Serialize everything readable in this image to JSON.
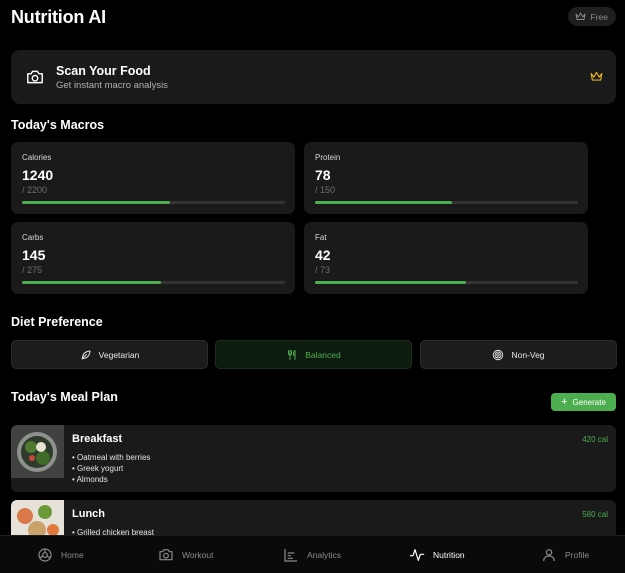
{
  "header": {
    "title": "Nutrition AI",
    "free_badge": "Free"
  },
  "scan": {
    "title": "Scan Your Food",
    "subtitle": "Get instant macro analysis"
  },
  "macros": {
    "section_title": "Today's Macros",
    "items": [
      {
        "label": "Calories",
        "value": "1240",
        "goal": "/ 2200",
        "progress": 0.564
      },
      {
        "label": "Protein",
        "value": "78",
        "goal": "/ 150",
        "progress": 0.52
      },
      {
        "label": "Carbs",
        "value": "145",
        "goal": "/ 275",
        "progress": 0.527
      },
      {
        "label": "Fat",
        "value": "42",
        "goal": "/ 73",
        "progress": 0.575
      }
    ]
  },
  "diet": {
    "section_title": "Diet Preference",
    "options": [
      {
        "label": "Vegetarian",
        "icon": "leaf-icon",
        "selected": false
      },
      {
        "label": "Balanced",
        "icon": "utensils-icon",
        "selected": true
      },
      {
        "label": "Non-Veg",
        "icon": "target-icon",
        "selected": false
      }
    ]
  },
  "meal_plan": {
    "section_title": "Today's Meal Plan",
    "generate_label": "Generate",
    "meals": [
      {
        "name": "Breakfast",
        "calories": "420 cal",
        "items": [
          "Oatmeal with berries",
          "Greek yogurt",
          "Almonds"
        ]
      },
      {
        "name": "Lunch",
        "calories": "580 cal",
        "items": [
          "Grilled chicken breast"
        ]
      }
    ]
  },
  "nav": {
    "items": [
      {
        "label": "Home",
        "icon": "home-icon",
        "active": false
      },
      {
        "label": "Workout",
        "icon": "camera-icon",
        "active": false
      },
      {
        "label": "Analytics",
        "icon": "analytics-icon",
        "active": false
      },
      {
        "label": "Nutrition",
        "icon": "activity-icon",
        "active": true
      },
      {
        "label": "Profile",
        "icon": "user-icon",
        "active": false
      }
    ]
  },
  "colors": {
    "accent": "#4cae4f",
    "card": "#1a1a1a",
    "background": "#000000",
    "crown": "#e2b526"
  }
}
